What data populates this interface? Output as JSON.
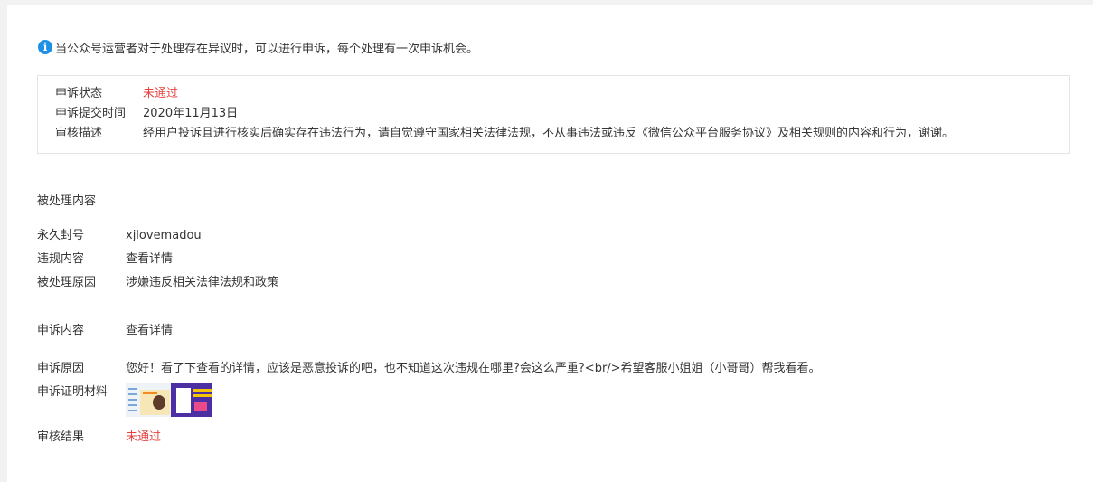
{
  "notice": {
    "text": "当公众号运营者对于处理存在异议时，可以进行申诉，每个处理有一次申诉机会。",
    "icon": "info-icon"
  },
  "appeal_status": {
    "rows": [
      {
        "label": "申诉状态",
        "value": "未通过"
      },
      {
        "label": "申诉提交时间",
        "value": "2020年11月13日"
      },
      {
        "label": "审核描述",
        "value": "经用户投诉且进行核实后确实存在违法行为，请自觉遵守国家相关法律法规，不从事违法或违反《微信公众平台服务协议》及相关规则的内容和行为，谢谢。"
      }
    ]
  },
  "handled_content": {
    "title": "被处理内容",
    "rows": [
      {
        "label": "永久封号",
        "value": "xjlovemadou"
      },
      {
        "label": "违规内容",
        "value": "查看详情"
      },
      {
        "label": "被处理原因",
        "value": "涉嫌违反相关法律法规和政策"
      }
    ]
  },
  "appeal_content": {
    "title": "申诉内容",
    "link": "查看详情",
    "reason_label": "申诉原因",
    "reason_value": "您好！看了下查看的详情，应该是恶意投诉的吧，也不知道这次违规在哪里?会这么严重?<br/>希望客服小姐姐（小哥哥）帮我看看。",
    "evidence_label": "申诉证明材料",
    "result_label": "审核结果",
    "result_value": "未通过"
  },
  "colors": {
    "accent_red": "#e64340",
    "link_blue": "#576b95",
    "info_blue": "#1e90e6"
  }
}
